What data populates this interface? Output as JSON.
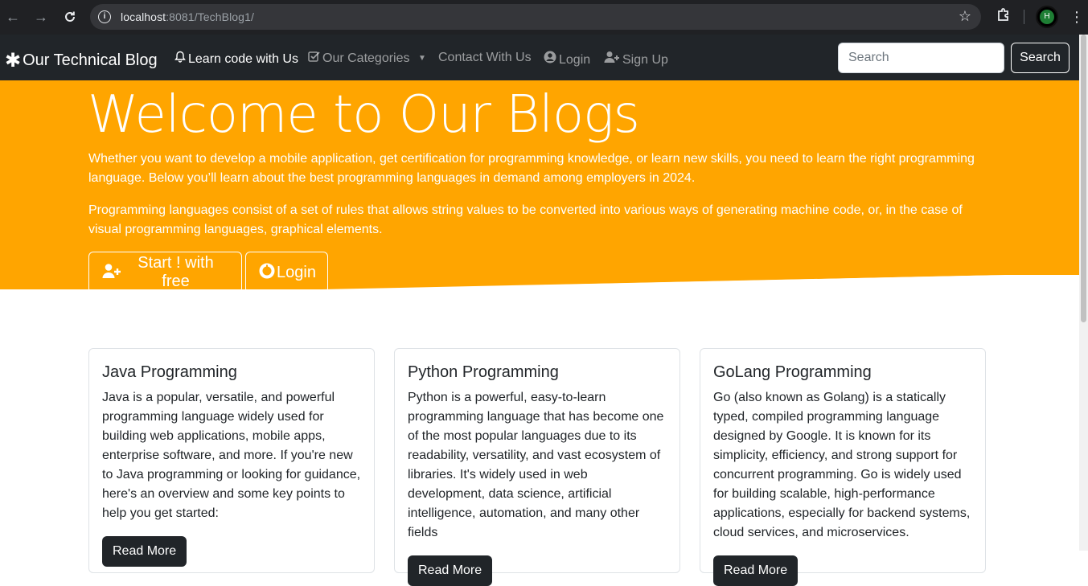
{
  "browser": {
    "url_host": "localhost",
    "url_path": ":8081/TechBlog1/",
    "profile_initial": "H"
  },
  "navbar": {
    "brand": "Our Technical Blog",
    "links": [
      {
        "label": "Learn code with Us",
        "icon": "bell-icon"
      },
      {
        "label": "Our Categories",
        "icon": "check-square-icon"
      },
      {
        "label": "Contact With Us",
        "icon": ""
      },
      {
        "label": "Login",
        "icon": "user-circle-icon"
      },
      {
        "label": "Sign Up",
        "icon": "user-plus-icon"
      }
    ],
    "search_placeholder": "Search",
    "search_button": "Search"
  },
  "hero": {
    "title": "Welcome to Our Blogs",
    "para1": "Whether you want to develop a mobile application, get certification for programming knowledge, or learn new skills, you need to learn the right programming language. Below you’ll learn about the best programming languages in demand among employers in 2024.",
    "para2": "Programming languages consist of a set of rules that allows string values to be converted into various ways of generating machine code, or, in the case of visual programming languages, graphical elements.",
    "btn_start": "Start ! with free",
    "btn_login": "Login",
    "bg_color": "#ffa500"
  },
  "cards": [
    {
      "title": "Java Programming",
      "text": "Java is a popular, versatile, and powerful programming language widely used for building web applications, mobile apps, enterprise software, and more. If you're new to Java programming or looking for guidance, here's an overview and some key points to help you get started:",
      "button": "Read More"
    },
    {
      "title": "Python Programming",
      "text": "Python is a powerful, easy-to-learn programming language that has become one of the most popular languages due to its readability, versatility, and vast ecosystem of libraries. It's widely used in web development, data science, artificial intelligence, automation, and many other fields",
      "button": "Read More"
    },
    {
      "title": "GoLang Programming",
      "text": "Go (also known as Golang) is a statically typed, compiled programming language designed by Google. It is known for its simplicity, efficiency, and strong support for concurrent programming. Go is widely used for building scalable, high-performance applications, especially for backend systems, cloud services, and microservices.",
      "button": "Read More"
    }
  ]
}
